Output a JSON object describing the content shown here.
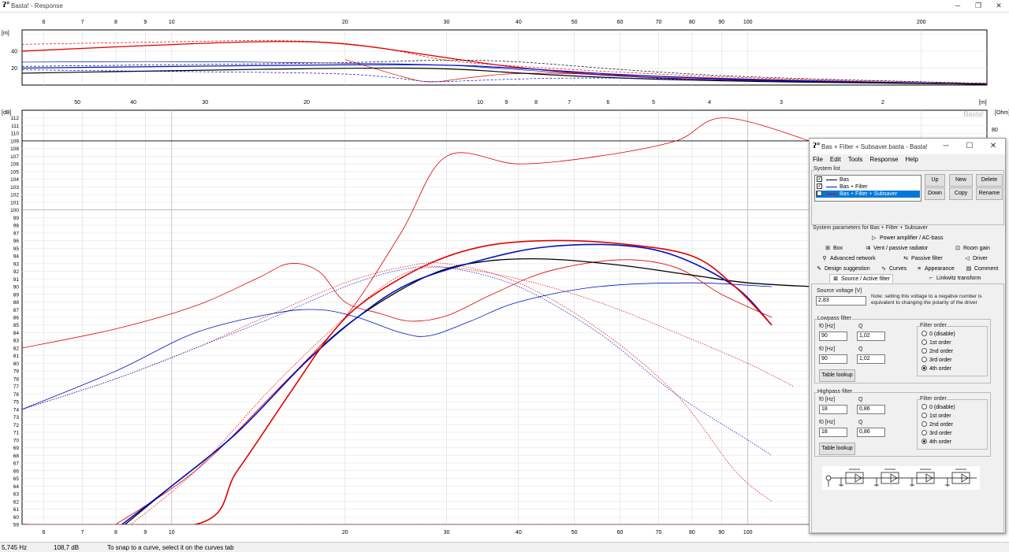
{
  "window": {
    "title": "Basta! - Response",
    "logo": "ʔ°"
  },
  "top_chart": {
    "y_unit": "[m]",
    "y_ticks": [
      {
        "value": 40,
        "label": "40"
      },
      {
        "value": 20,
        "label": "20"
      }
    ],
    "y_range": [
      0,
      65
    ],
    "x_ticks": [
      {
        "value": 6,
        "label": "6"
      },
      {
        "value": 7,
        "label": "7"
      },
      {
        "value": 8,
        "label": "8"
      },
      {
        "value": 9,
        "label": "9"
      },
      {
        "value": 10,
        "label": "10"
      },
      {
        "value": 20,
        "label": "20"
      },
      {
        "value": 30,
        "label": "30"
      },
      {
        "value": 40,
        "label": "40"
      },
      {
        "value": 50,
        "label": "50"
      },
      {
        "value": 60,
        "label": "60"
      },
      {
        "value": 70,
        "label": "70"
      },
      {
        "value": 80,
        "label": "80"
      },
      {
        "value": 90,
        "label": "90"
      },
      {
        "value": 100,
        "label": "100"
      },
      {
        "value": 200,
        "label": "200"
      }
    ]
  },
  "chart_data": {
    "type": "line",
    "y_unit": "[dB]",
    "y2_unit": "[Ohm]",
    "y2_ticks": [
      "80"
    ],
    "wavelength_unit": "[m]",
    "watermark": "Basta!",
    "x_range": [
      5.5,
      260
    ],
    "y_range": [
      59,
      113
    ],
    "y_ticks": [
      59,
      60,
      61,
      62,
      63,
      64,
      65,
      66,
      67,
      68,
      69,
      70,
      71,
      72,
      73,
      74,
      75,
      76,
      77,
      78,
      79,
      80,
      81,
      82,
      83,
      84,
      85,
      86,
      87,
      88,
      89,
      90,
      91,
      92,
      93,
      94,
      95,
      96,
      97,
      98,
      99,
      100,
      101,
      102,
      103,
      104,
      105,
      106,
      107,
      108,
      109,
      110,
      111,
      112
    ],
    "x_ticks": [
      {
        "value": 6,
        "label": "6"
      },
      {
        "value": 7,
        "label": "7"
      },
      {
        "value": 8,
        "label": "8"
      },
      {
        "value": 9,
        "label": "9"
      },
      {
        "value": 10,
        "label": "10"
      },
      {
        "value": 20,
        "label": "20"
      },
      {
        "value": 30,
        "label": "30"
      },
      {
        "value": 40,
        "label": "40"
      },
      {
        "value": 50,
        "label": "50"
      },
      {
        "value": 60,
        "label": "60"
      },
      {
        "value": 70,
        "label": "70"
      },
      {
        "value": 80,
        "label": "80"
      },
      {
        "value": 90,
        "label": "90"
      },
      {
        "value": 100,
        "label": "100"
      }
    ],
    "wavelength_ticks": [
      {
        "value": 6.86,
        "label": "50"
      },
      {
        "value": 8.58,
        "label": "40"
      },
      {
        "value": 11.43,
        "label": "30"
      },
      {
        "value": 17.15,
        "label": "20"
      },
      {
        "value": 34.3,
        "label": "10"
      },
      {
        "value": 38.1,
        "label": "9"
      },
      {
        "value": 42.9,
        "label": "8"
      },
      {
        "value": 49.0,
        "label": "7"
      },
      {
        "value": 57.2,
        "label": "6"
      },
      {
        "value": 68.6,
        "label": "5"
      },
      {
        "value": 85.8,
        "label": "4"
      },
      {
        "value": 114.3,
        "label": "3"
      },
      {
        "value": 171.5,
        "label": "2"
      }
    ],
    "reference_lines": [
      100,
      109
    ],
    "series": [
      {
        "name": "Bas + Filter + Subsaver",
        "color": "#e00000",
        "width": 1.6,
        "style": "solid",
        "points": [
          [
            5.5,
            59
          ],
          [
            11,
            59
          ],
          [
            13,
            66
          ],
          [
            16,
            76
          ],
          [
            19,
            84
          ],
          [
            22,
            88.5
          ],
          [
            28,
            93
          ],
          [
            35,
            95.3
          ],
          [
            45,
            96
          ],
          [
            60,
            95.6
          ],
          [
            80,
            94
          ],
          [
            95,
            90
          ],
          [
            110,
            85
          ]
        ]
      },
      {
        "name": "Bas + Filter",
        "color": "#0010c0",
        "width": 1.6,
        "style": "solid",
        "points": [
          [
            8.2,
            59
          ],
          [
            10,
            64
          ],
          [
            13,
            71
          ],
          [
            17,
            80
          ],
          [
            21,
            86
          ],
          [
            26,
            90.5
          ],
          [
            35,
            93.6
          ],
          [
            45,
            95.2
          ],
          [
            60,
            95.4
          ],
          [
            75,
            94
          ],
          [
            95,
            90
          ],
          [
            110,
            85
          ]
        ]
      },
      {
        "name": "Bas",
        "color": "#000000",
        "width": 1.3,
        "style": "solid",
        "points": [
          [
            8.3,
            59
          ],
          [
            10,
            64
          ],
          [
            13,
            71
          ],
          [
            17,
            80
          ],
          [
            21,
            86
          ],
          [
            28,
            91.5
          ],
          [
            35,
            93.3
          ],
          [
            45,
            93.6
          ],
          [
            60,
            92.8
          ],
          [
            80,
            91.5
          ],
          [
            100,
            90.5
          ],
          [
            130,
            90
          ]
        ]
      },
      {
        "name": "",
        "color": "#e00000",
        "width": 0.8,
        "style": "solid",
        "points": [
          [
            5.5,
            82
          ],
          [
            8,
            84.5
          ],
          [
            11,
            87.5
          ],
          [
            14,
            91
          ],
          [
            16,
            93
          ],
          [
            18,
            92
          ],
          [
            20,
            88
          ],
          [
            23,
            86.5
          ],
          [
            26,
            85.5
          ],
          [
            30,
            86.2
          ],
          [
            36,
            89
          ],
          [
            45,
            92
          ],
          [
            60,
            93.5
          ],
          [
            75,
            92.5
          ],
          [
            90,
            89
          ],
          [
            110,
            86
          ]
        ]
      },
      {
        "name": "",
        "color": "#0010c0",
        "width": 0.8,
        "style": "solid",
        "points": [
          [
            5.5,
            74
          ],
          [
            8,
            79
          ],
          [
            11,
            84
          ],
          [
            15,
            86.5
          ],
          [
            18,
            87
          ],
          [
            21,
            86
          ],
          [
            25,
            84
          ],
          [
            28,
            83.6
          ],
          [
            33,
            85.5
          ],
          [
            40,
            88
          ],
          [
            55,
            90
          ],
          [
            80,
            90.5
          ],
          [
            110,
            90
          ]
        ]
      },
      {
        "name": "",
        "color": "#e00000",
        "width": 0.8,
        "style": "solid",
        "points": [
          [
            8,
            59
          ],
          [
            11,
            66
          ],
          [
            15,
            76
          ],
          [
            20,
            86
          ],
          [
            25,
            97
          ],
          [
            30,
            107
          ],
          [
            40,
            106
          ],
          [
            55,
            107
          ],
          [
            75,
            109
          ],
          [
            92,
            112
          ],
          [
            140,
            108
          ]
        ]
      },
      {
        "name": "",
        "color": "#e00000",
        "width": 0.7,
        "style": "dotted",
        "points": [
          [
            8.5,
            59
          ],
          [
            11,
            66
          ],
          [
            15,
            77
          ],
          [
            20,
            86
          ],
          [
            25,
            91.5
          ],
          [
            30,
            92.5
          ],
          [
            40,
            91
          ],
          [
            55,
            88
          ],
          [
            75,
            84
          ],
          [
            100,
            80
          ],
          [
            120,
            77
          ]
        ]
      },
      {
        "name": "",
        "color": "#0010c0",
        "width": 0.7,
        "style": "dotted",
        "points": [
          [
            5.5,
            74
          ],
          [
            8,
            78
          ],
          [
            11,
            82
          ],
          [
            15,
            86
          ],
          [
            20,
            90
          ],
          [
            25,
            92.2
          ],
          [
            30,
            92.5
          ],
          [
            40,
            90
          ],
          [
            55,
            84
          ],
          [
            75,
            76
          ],
          [
            100,
            70
          ],
          [
            110,
            68
          ]
        ]
      },
      {
        "name": "",
        "color": "#e00000",
        "width": 0.7,
        "style": "dotted",
        "points": [
          [
            5.5,
            74
          ],
          [
            8,
            78
          ],
          [
            11,
            82
          ],
          [
            15,
            86.5
          ],
          [
            20,
            90.5
          ],
          [
            25,
            92.5
          ],
          [
            30,
            93
          ],
          [
            40,
            90.5
          ],
          [
            55,
            84.5
          ],
          [
            75,
            76
          ],
          [
            95,
            66
          ],
          [
            110,
            62
          ]
        ]
      }
    ]
  },
  "statusbar": {
    "freq": "5,745 Hz",
    "level": "108,7 dB",
    "hint": "To snap to a curve, select it on the curves tab"
  },
  "dialog": {
    "title": "Bas + Filter + Subsaver.basta - Basta!",
    "menu": [
      "File",
      "Edit",
      "Tools",
      "Response",
      "Help"
    ],
    "system_list_label": "System list",
    "systems": [
      {
        "name": "Bas",
        "color": "#000000",
        "checked": "✓"
      },
      {
        "name": "Bas + Filter",
        "color": "#0010c0",
        "checked": "✓"
      },
      {
        "name": "Bas + Filter + Subsaver",
        "color": "#e00000",
        "checked": "✓"
      }
    ],
    "buttons": {
      "up": "Up",
      "new": "New",
      "delete": "Delete",
      "down": "Down",
      "copy": "Copy",
      "rename": "Rename"
    },
    "params_label": "System parameters for Bas + Filter + Subsaver",
    "tabs": [
      {
        "label": "Power amplifier / AC-bass",
        "icon": "▷"
      },
      {
        "label": "Box",
        "icon": "⊞"
      },
      {
        "label": "Vent / passive radiator",
        "icon": "⇉"
      },
      {
        "label": "Room gain",
        "icon": "⊡"
      },
      {
        "label": "Advanced network",
        "icon": "⚲"
      },
      {
        "label": "Passive filter",
        "icon": "⇆"
      },
      {
        "label": "Driver",
        "icon": "◁"
      },
      {
        "label": "Design suggestion",
        "icon": "✎"
      },
      {
        "label": "Curves",
        "icon": "∿"
      },
      {
        "label": "Appearance",
        "icon": "≡"
      },
      {
        "label": "Comment",
        "icon": "▤"
      },
      {
        "label": "Source / Active filter",
        "icon": "⊠"
      },
      {
        "label": "Linkwitz transform",
        "icon": "⌐"
      }
    ],
    "source_voltage_label": "Source voltage [V]",
    "source_voltage": "2,83",
    "note": "Note: setting this voltage to a negative number is equivalent to changing the polarity of the driver",
    "lowpass": {
      "title": "Lowpass filter",
      "f0_label": "f0 [Hz]",
      "q_label": "Q",
      "f0_1": "90",
      "q_1": "1,02",
      "f0_2": "90",
      "q_2": "1,02",
      "table_lookup": "Table lookup",
      "order_title": "Filter order",
      "orders": [
        "0 (disable)",
        "1st order",
        "2nd order",
        "3rd order",
        "4th order"
      ],
      "selected": "4th order"
    },
    "highpass": {
      "title": "Highpass filter",
      "f0_label": "f0 [Hz]",
      "q_label": "Q",
      "f0_1": "18",
      "q_1": "0,86",
      "f0_2": "18",
      "q_2": "0,86",
      "table_lookup": "Table lookup",
      "order_title": "Filter order",
      "orders": [
        "0 (disable)",
        "1st order",
        "2nd order",
        "3rd order",
        "4th order"
      ],
      "selected": "4th order"
    }
  }
}
